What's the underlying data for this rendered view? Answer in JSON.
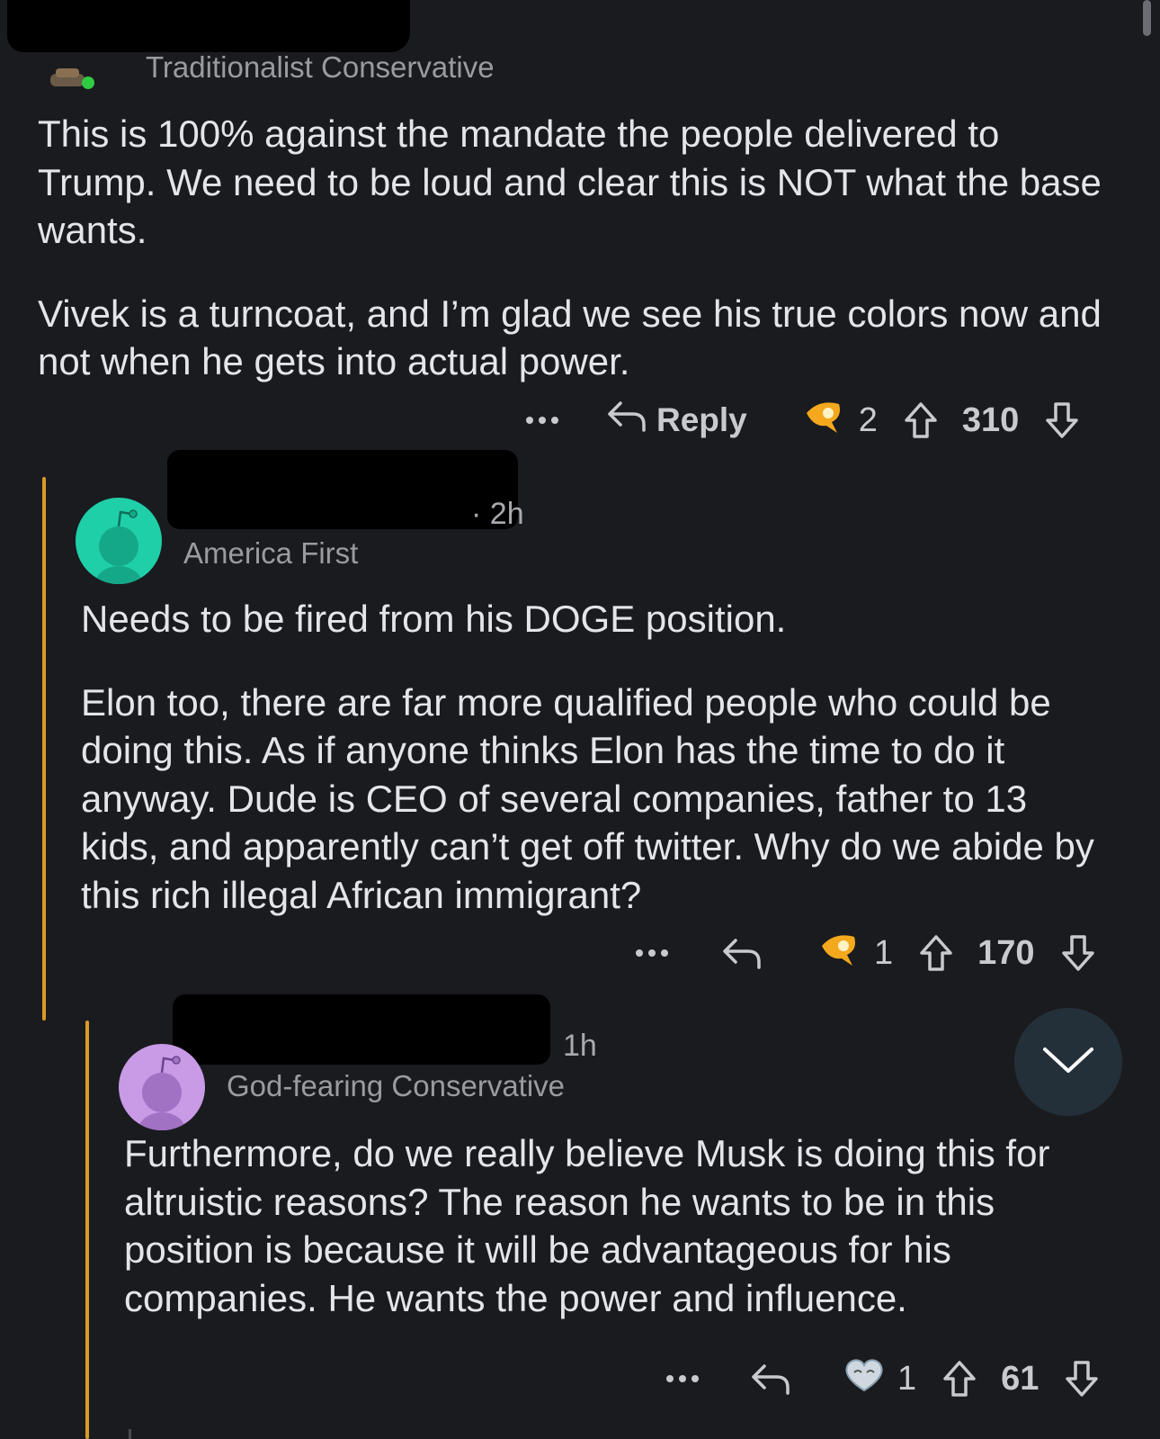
{
  "comments": [
    {
      "flair": "Traditionalist Conservative",
      "paragraphs": [
        "This is 100% against the mandate the people delivered to Trump. We need to be loud and clear this is NOT what the base wants.",
        "Vivek is a turncoat, and I’m glad we see his true colors now and not when he gets into actual power."
      ],
      "reply_label": "Reply",
      "award_count": "2",
      "score": "310"
    },
    {
      "time": "2h",
      "flair": "America First",
      "paragraphs": [
        "Needs to be fired from his DOGE position.",
        "Elon too, there are far more qualified people who could be doing this. As if anyone thinks Elon has the time to do it anyway. Dude is CEO of several companies, father to 13 kids, and apparently can’t get off twitter. Why do we abide by this rich illegal African immigrant?"
      ],
      "award_count": "1",
      "score": "170",
      "avatar_color": "#1fcfa8"
    },
    {
      "time": "1h",
      "flair": "God-fearing Conservative",
      "paragraphs": [
        "Furthermore, do we really believe Musk is doing this for altruistic reasons? The reason he wants to be in this position is because it will be advantageous for his companies. He wants the power and influence."
      ],
      "award_count": "1",
      "score": "61",
      "avatar_color": "#c99ae6"
    }
  ],
  "icons": {
    "more": "more-dots-icon",
    "reply": "reply-arrow-icon",
    "award": "award-icon",
    "upvote": "upvote-arrow-icon",
    "downvote": "downvote-arrow-icon",
    "collapse": "chevron-down-icon"
  },
  "colors": {
    "background": "#1a1b1f",
    "thread_line": "#d89a2a",
    "online_dot": "#2ecc40",
    "fab": "#243039"
  }
}
